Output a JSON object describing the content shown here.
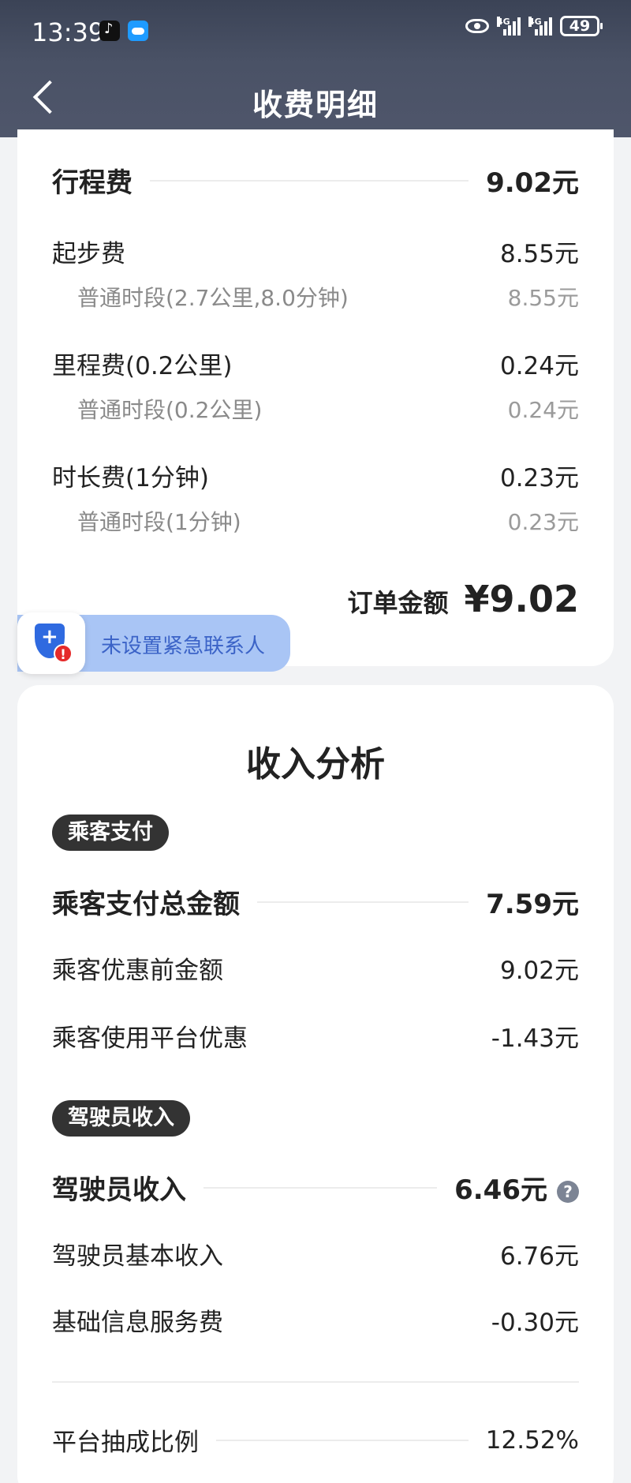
{
  "status_bar": {
    "time": "13:39",
    "network1": "4G",
    "network2": "4G",
    "battery": "49"
  },
  "header": {
    "title": "收费明细"
  },
  "fare": {
    "trip": {
      "label": "行程费",
      "value": "9.02元"
    },
    "base": {
      "label": "起步费",
      "value": "8.55元",
      "sub_label": "普通时段(2.7公里,8.0分钟)",
      "sub_value": "8.55元"
    },
    "mileage": {
      "label": "里程费(0.2公里)",
      "value": "0.24元",
      "sub_label": "普通时段(0.2公里)",
      "sub_value": "0.24元"
    },
    "duration": {
      "label": "时长费(1分钟)",
      "value": "0.23元",
      "sub_label": "普通时段(1分钟)",
      "sub_value": "0.23元"
    },
    "order_total_label": "订单金额",
    "order_total_value": "¥9.02"
  },
  "emergency": {
    "text": "未设置紧急联系人"
  },
  "analysis": {
    "title": "收入分析",
    "passenger_tag": "乘客支付",
    "passenger_total": {
      "label": "乘客支付总金额",
      "value": "7.59元"
    },
    "passenger_before": {
      "label": "乘客优惠前金额",
      "value": "9.02元"
    },
    "passenger_discount": {
      "label": "乘客使用平台优惠",
      "value": "-1.43元"
    },
    "driver_tag": "驾驶员收入",
    "driver_income": {
      "label": "驾驶员收入",
      "value": "6.46元",
      "help": "?"
    },
    "driver_base": {
      "label": "驾驶员基本收入",
      "value": "6.76元"
    },
    "service_fee": {
      "label": "基础信息服务费",
      "value": "-0.30元"
    },
    "commission": {
      "label": "平台抽成比例",
      "value": "12.52%"
    }
  }
}
